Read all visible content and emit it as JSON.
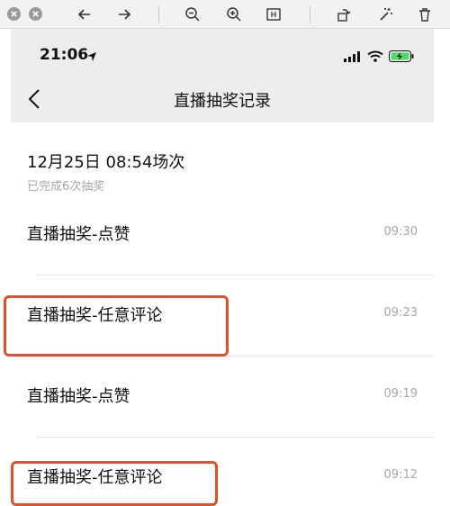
{
  "colors": {
    "toolbar_bg": "#f2f2f2",
    "nav_bg": "#ededed",
    "highlight": "#d9532c",
    "battery_green": "#4cd964",
    "muted_text": "#a6a6a6"
  },
  "toolbar": {
    "icons": [
      "close-icon",
      "minimize-icon",
      "arrow-left-icon",
      "arrow-right-icon",
      "zoom-out-icon",
      "zoom-in-icon",
      "fit-screen-icon",
      "rotate-icon",
      "magic-wand-icon",
      "delete-icon"
    ]
  },
  "status_bar": {
    "time": "21:06",
    "icons": [
      "location-arrow-icon",
      "signal-icon",
      "wifi-icon",
      "battery-charging-icon"
    ]
  },
  "nav": {
    "title": "直播抽奖记录",
    "back_icon": "chevron-left-icon"
  },
  "session": {
    "title": "12月25日 08:54场次",
    "subtitle": "已完成6次抽奖"
  },
  "records": [
    {
      "name": "直播抽奖-点赞",
      "time": "09:30",
      "highlighted": false
    },
    {
      "name": "直播抽奖-任意评论",
      "time": "09:23",
      "highlighted": true
    },
    {
      "name": "直播抽奖-点赞",
      "time": "09:19",
      "highlighted": false
    },
    {
      "name": "直播抽奖-任意评论",
      "time": "09:12",
      "highlighted": true
    }
  ]
}
